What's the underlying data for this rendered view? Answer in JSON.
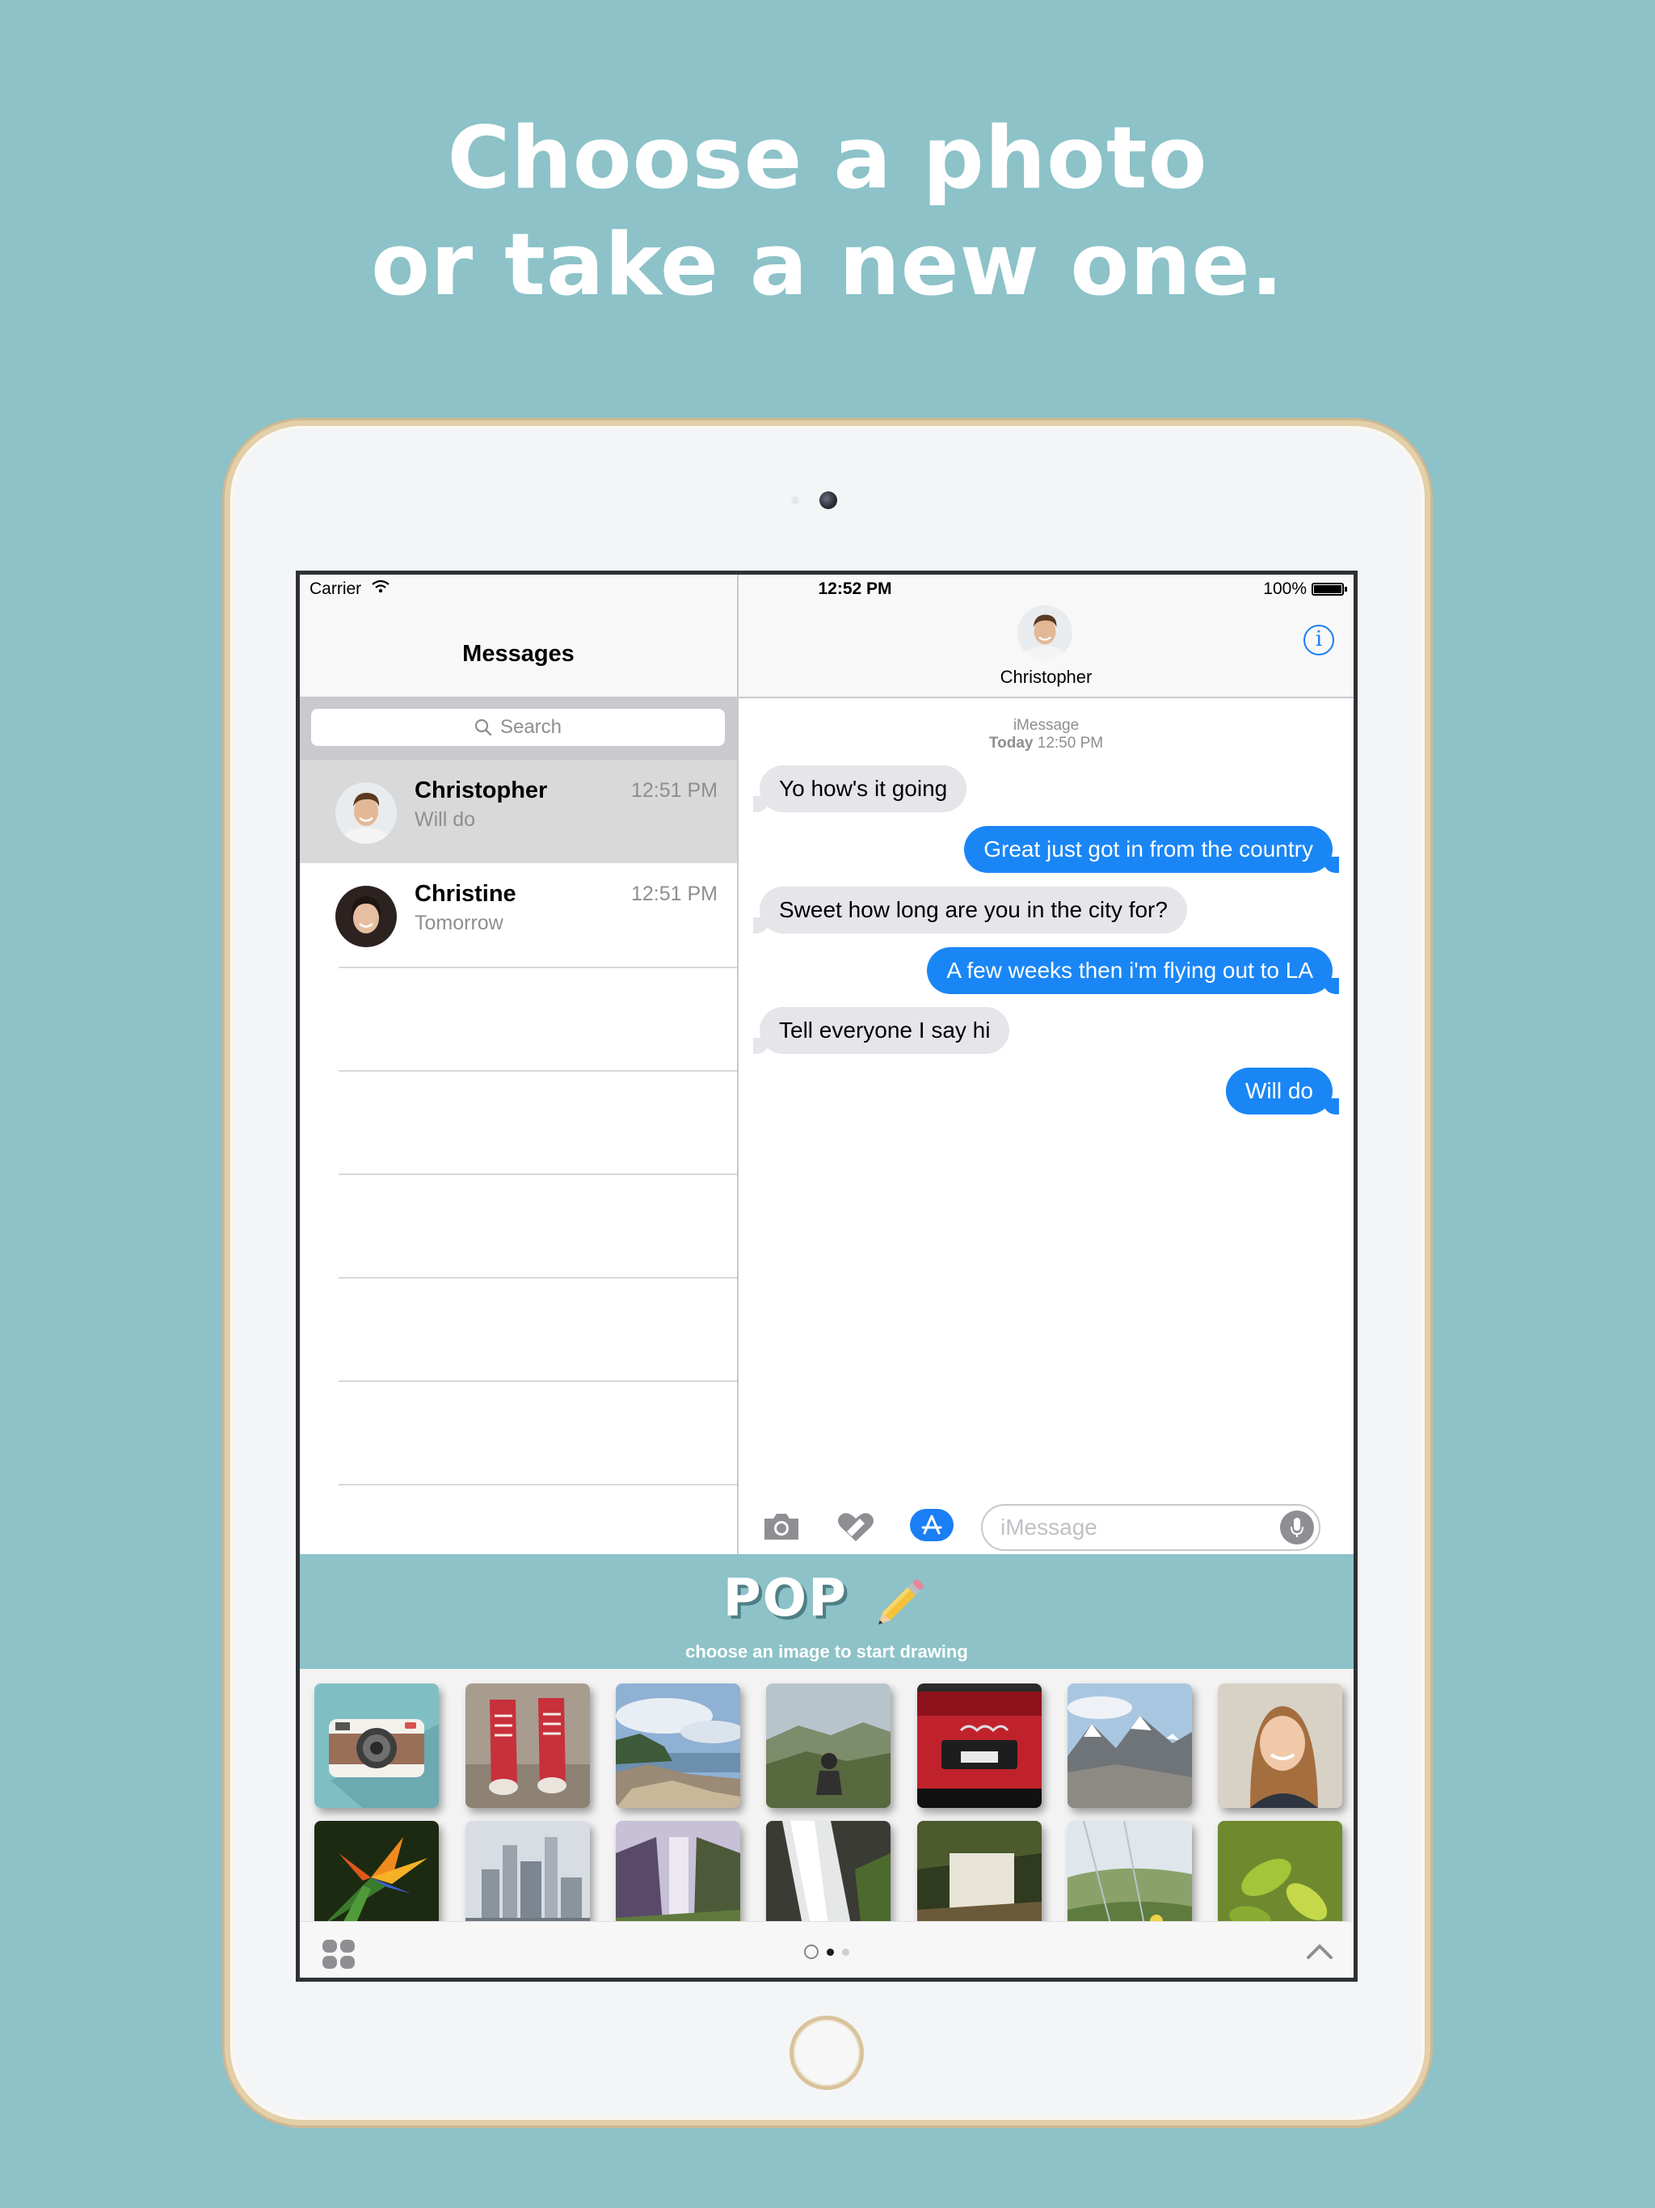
{
  "headline": {
    "line1": "Choose a photo",
    "line2": "or take a new one."
  },
  "status_bar": {
    "carrier": "Carrier",
    "time": "12:52 PM",
    "battery": "100%"
  },
  "sidebar": {
    "title": "Messages",
    "search_placeholder": "Search",
    "conversations": [
      {
        "name": "Christopher",
        "preview": "Will do",
        "time": "12:51 PM",
        "selected": true
      },
      {
        "name": "Christine",
        "preview": "Tomorrow",
        "time": "12:51 PM",
        "selected": false
      }
    ]
  },
  "conversation": {
    "contact_name": "Christopher",
    "service": "iMessage",
    "date_label": "Today",
    "date_time": "12:50 PM",
    "messages": [
      {
        "direction": "in",
        "text": "Yo how's it going"
      },
      {
        "direction": "out",
        "text": "Great just got in from the country"
      },
      {
        "direction": "in",
        "text": "Sweet how long are you in the city for?"
      },
      {
        "direction": "out",
        "text": "A few weeks then i'm flying out to LA"
      },
      {
        "direction": "in",
        "text": "Tell everyone I say hi"
      },
      {
        "direction": "out",
        "text": "Will do"
      }
    ],
    "input_placeholder": "iMessage"
  },
  "extension": {
    "logo": "POP",
    "tagline": "choose an image to start drawing",
    "photos": [
      "camera-tile",
      "red-sneakers",
      "rocky-coast",
      "mountain-hiker",
      "red-car",
      "snowy-mountains",
      "smiling-woman",
      "bird-of-paradise-flower",
      "city-skyline",
      "waterfall-valley",
      "rushing-waterfall",
      "misty-falls",
      "hillside-flowers",
      "green-leaves"
    ],
    "page_indicator": {
      "pages": 2,
      "current": 1
    }
  },
  "colors": {
    "background": "#8cc2c8",
    "imessage_blue": "#1a86f5",
    "incoming_bubble": "#e5e5ea",
    "selected_row": "#d9d9d9"
  }
}
